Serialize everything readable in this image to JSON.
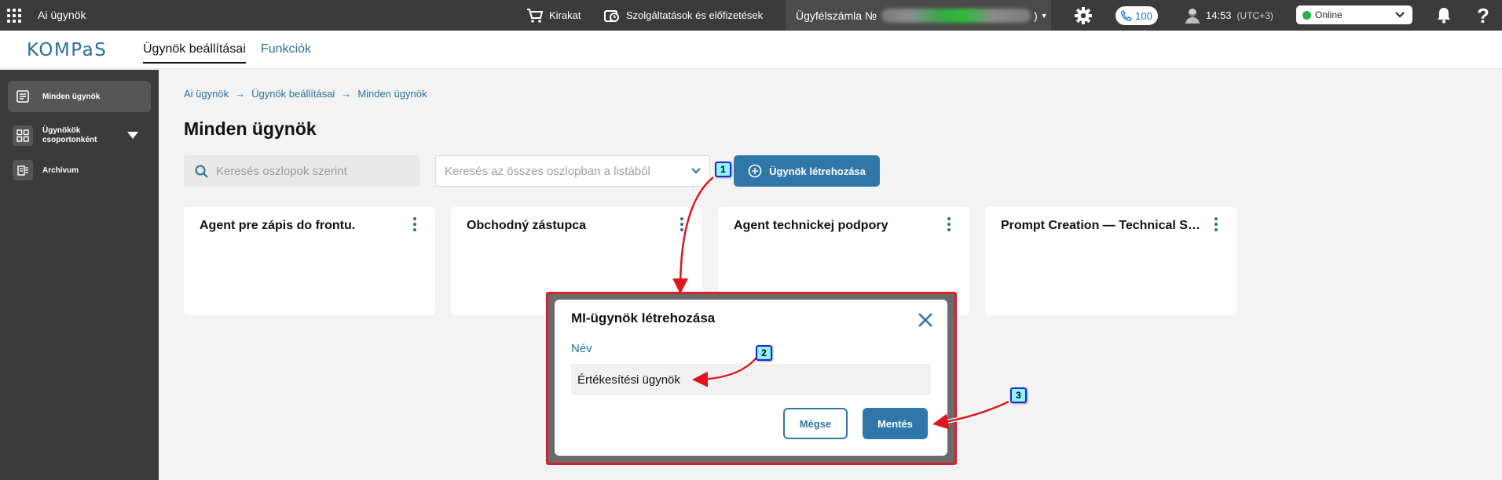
{
  "topbar": {
    "app_title": "Ai ügynök",
    "shop_label": "Kirakat",
    "services_label": "Szolgáltatások és előfizetések",
    "account_label": "Ügyfélszámla №",
    "account_suffix": ")",
    "calls_count": "100",
    "time": "14:53",
    "timezone": "(UTC+3)",
    "status_value": "Online",
    "help_label": "?"
  },
  "subheader": {
    "logo_text": "KOMPaS",
    "tabs": [
      {
        "label": "Ügynök beállításai",
        "active": true
      },
      {
        "label": "Funkciók",
        "active": false
      }
    ]
  },
  "sidebar": {
    "items": [
      {
        "label": "Minden ügynök",
        "icon": "document-icon",
        "active": true
      },
      {
        "label_line1": "Ügynökök",
        "label_line2": "csoportonként",
        "icon": "grid-icon"
      },
      {
        "label": "Archívum",
        "icon": "archive-icon"
      }
    ]
  },
  "breadcrumb": [
    "Ai ügynök",
    "Ügynök beállításai",
    "Minden ügynök"
  ],
  "page_title": "Minden ügynök",
  "search": {
    "placeholder": "Keresés oszlopok szerint"
  },
  "column_select": {
    "placeholder": "Keresés az összes oszlopban a listából"
  },
  "create_button": "Ügynök létrehozása",
  "cards": [
    {
      "title": "Agent pre zápis do frontu."
    },
    {
      "title": "Obchodný zástupca"
    },
    {
      "title": "Agent technickej podpory"
    },
    {
      "title": "Prompt Creation — Technical Support"
    }
  ],
  "modal": {
    "title": "MI-ügynök létrehozása",
    "field_label": "Név",
    "field_value": "Értékesítési ügynök",
    "cancel_label": "Mégse",
    "save_label": "Mentés"
  },
  "annotations": [
    "1",
    "2",
    "3"
  ],
  "colors": {
    "accent": "#2f77a8",
    "topbar": "#3b3b3b",
    "status_online": "#23b14d",
    "highlight_frame": "#d81f2a",
    "arrow": "#e0141e"
  }
}
